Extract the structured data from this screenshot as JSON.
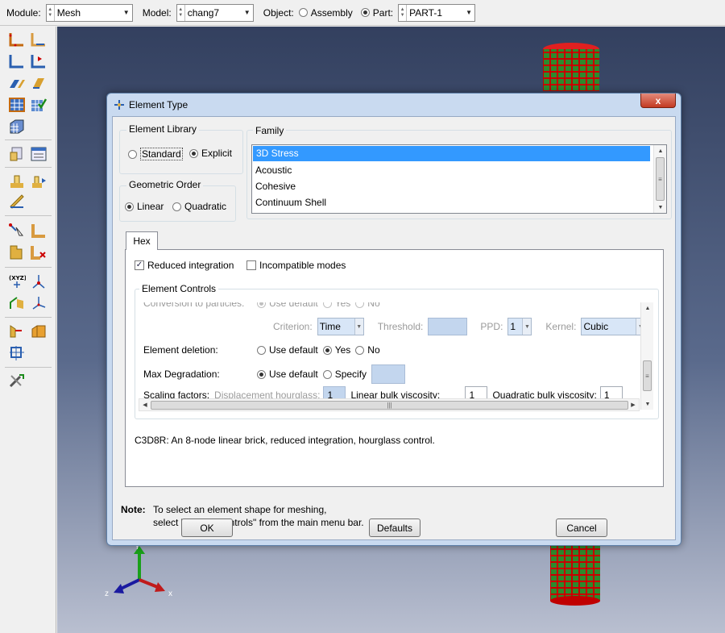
{
  "context_bar": {
    "module_label": "Module:",
    "module_value": "Mesh",
    "model_label": "Model:",
    "model_value": "chang7",
    "object_label": "Object:",
    "assembly_label": "Assembly",
    "part_label": "Part:",
    "part_value": "PART-1"
  },
  "viewport": {
    "triad": {
      "y": "Y",
      "z": "z",
      "x": "x"
    }
  },
  "dialog": {
    "title": "Element Type",
    "close_label": "x",
    "element_library": {
      "label": "Element Library",
      "options": [
        "Standard",
        "Explicit"
      ],
      "selected": "Explicit"
    },
    "geometric_order": {
      "label": "Geometric Order",
      "options": [
        "Linear",
        "Quadratic"
      ],
      "selected": "Linear"
    },
    "family": {
      "label": "Family",
      "items": [
        "3D Stress",
        "Acoustic",
        "Cohesive",
        "Continuum Shell"
      ],
      "selected": "3D Stress"
    },
    "tab": "Hex",
    "reduced_integration": {
      "label": "Reduced integration",
      "checked": true
    },
    "incompatible_modes": {
      "label": "Incompatible modes",
      "checked": false
    },
    "element_controls": {
      "label": "Element Controls",
      "conversion": {
        "label": "Conversion to particles:",
        "options": [
          "Use default",
          "Yes",
          "No"
        ]
      },
      "criterion": {
        "label": "Criterion:",
        "value": "Time"
      },
      "threshold": {
        "label": "Threshold:",
        "value": ""
      },
      "ppd": {
        "label": "PPD:",
        "value": "1"
      },
      "kernel": {
        "label": "Kernel:",
        "value": "Cubic"
      },
      "element_deletion": {
        "label": "Element deletion:",
        "options": [
          "Use default",
          "Yes",
          "No"
        ],
        "selected": "Yes"
      },
      "max_degradation": {
        "label": "Max Degradation:",
        "options": [
          "Use default",
          "Specify"
        ],
        "selected": "Use default"
      },
      "scaling": {
        "label": "Scaling factors:",
        "displacement_label": "Displacement hourglass:",
        "displacement_value": "1",
        "linear_label": "Linear bulk viscosity:",
        "linear_value": "1",
        "quadratic_label": "Quadratic bulk viscosity:",
        "quadratic_value": "1"
      }
    },
    "description": "C3D8R:  An 8-node linear brick, reduced integration, hourglass control.",
    "note": {
      "label": "Note:",
      "line1": "To select an element shape for meshing,",
      "line2": "select \"Mesh->Controls\" from the main menu bar."
    },
    "buttons": {
      "ok": "OK",
      "defaults": "Defaults",
      "cancel": "Cancel"
    }
  }
}
